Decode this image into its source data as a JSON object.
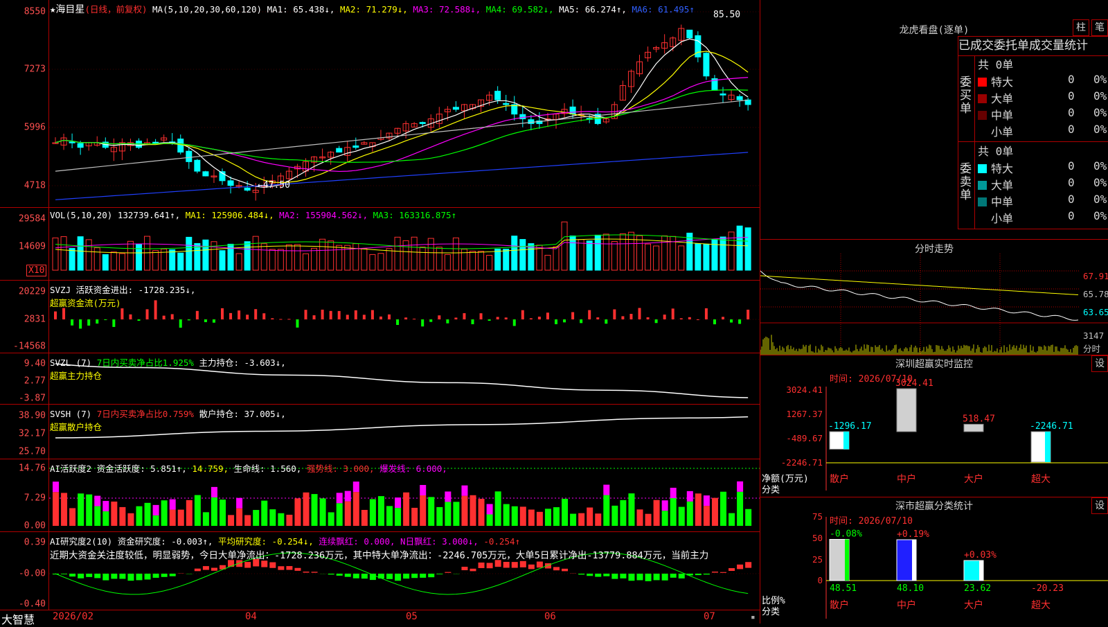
{
  "colors": {
    "up": "#ff3030",
    "down": "#00ffff",
    "bg": "#000000",
    "grid": "#b00000",
    "ma1": "#ffffff",
    "ma2": "#ffff00",
    "ma3": "#ff00ff",
    "ma4": "#00ff00",
    "ma5": "#c0c0c0",
    "ma6": "#2040ff"
  },
  "main_chart": {
    "title": "★海目星",
    "period": "(日线，前复权)",
    "ma_params": "MA(5,10,20,30,60,120)",
    "ma1": "MA1: 65.438↓,",
    "ma2": "MA2: 71.279↓,",
    "ma3": "MA3: 72.588↓,",
    "ma4": "MA4: 69.582↓,",
    "ma5": "MA5: 66.274↑,",
    "ma6": "MA6: 61.495↑",
    "y_ticks": [
      "8550",
      "7273",
      "5996",
      "4718"
    ],
    "high_label": "85.50",
    "low_label": "←47.50"
  },
  "volume": {
    "legend": "VOL(5,10,20)",
    "value": "132739.641↑,",
    "ma1": "MA1: 125906.484↓,",
    "ma2": "MA2: 155904.562↓,",
    "ma3": "MA3: 163316.875↑",
    "y_ticks": [
      "29584",
      "14609"
    ],
    "unit": "X10"
  },
  "svzj": {
    "legend": "SVZJ  活跃资金进出: -1728.235↓,",
    "sub": "超赢资金流(万元)",
    "y_ticks": [
      "20229",
      "2831",
      "-14568"
    ]
  },
  "svzl": {
    "legend_a": "SVZL (7)",
    "legend_b": "7日内买卖净占比1.925%",
    "legend_c": "主力持仓: -3.603↓,",
    "sub": "超赢主力持仓",
    "y_ticks": [
      "9.40",
      "2.77",
      "-3.87"
    ]
  },
  "svsh": {
    "legend_a": "SVSH (7)",
    "legend_b": "7日内买卖净占比0.759%",
    "legend_c": "散户持仓: 37.005↓,",
    "sub": "超赢散户持仓",
    "y_ticks": [
      "38.90",
      "32.17",
      "25.70"
    ]
  },
  "ai_active": {
    "a": "AI活跃度2 资金活跃度: 5.851↑,",
    "b": "14.759,",
    "c": "生命线: 1.560,",
    "d": "强势线: 3.000,",
    "e": "爆发线: 6.000,",
    "y_ticks": [
      "14.76",
      "7.29",
      "0.00"
    ]
  },
  "ai_research": {
    "a": "AI研究度2(10) 资金研究度: -0.003↑,",
    "b": "平均研究度: -0.254↓,",
    "c": "连续飘红: 0.000,",
    "d": "N日飘红: 3.000↓,",
    "e": "-0.254↑",
    "text": "近期大资金关注度较低，明显弱势，今日大单净流出：-1728.236万元，其中特大单净流出：-2246.705万元，大单5日累计净出-13779.884万元，当前主力",
    "y_ticks": [
      "0.39",
      "-0.00",
      "-0.40"
    ]
  },
  "x_axis": {
    "brand": "大智慧",
    "labels": [
      "2026/02",
      "04",
      "05",
      "06",
      "07"
    ]
  },
  "longhu": {
    "title": "龙虎看盘(逐单)",
    "btn_a": "柱",
    "btn_b": "笔",
    "tabs": [
      "已成交",
      "委托单",
      "成交量统计"
    ],
    "buy": {
      "side_label": "委买单",
      "total": "共 0单",
      "rows": [
        {
          "name": "特大",
          "count": "0",
          "pct": "0%"
        },
        {
          "name": "大单",
          "count": "0",
          "pct": "0%"
        },
        {
          "name": "中单",
          "count": "0",
          "pct": "0%"
        },
        {
          "name": "小单",
          "count": "0",
          "pct": "0%"
        }
      ]
    },
    "sell": {
      "side_label": "委卖单",
      "total": "共 0单",
      "rows": [
        {
          "name": "特大",
          "count": "0",
          "pct": "0%"
        },
        {
          "name": "大单",
          "count": "0",
          "pct": "0%"
        },
        {
          "name": "中单",
          "count": "0",
          "pct": "0%"
        },
        {
          "name": "小单",
          "count": "0",
          "pct": "0%"
        }
      ]
    }
  },
  "minute": {
    "title": "分时走势",
    "y_labels": [
      "67.91",
      "65.78",
      "63.65"
    ],
    "vol_label": "3147",
    "vol_unit": "分时"
  },
  "sz_monitor": {
    "title": "深圳超赢实时监控",
    "btn": "设",
    "time": "时间: 2026/07/10",
    "y_ticks": [
      "3024.41",
      "1267.37",
      "-489.67",
      "-2246.71"
    ],
    "ylab1": "净额(万元)",
    "ylab2": "分类",
    "bars": [
      {
        "cat": "散户",
        "value": "-1296.17"
      },
      {
        "cat": "中户",
        "value": "3024.41"
      },
      {
        "cat": "大户",
        "value": "518.47"
      },
      {
        "cat": "超大",
        "value": "-2246.71"
      }
    ]
  },
  "sz_class": {
    "title": "深市超赢分类统计",
    "btn": "设",
    "time": "时间: 2026/07/10",
    "y_ticks": [
      "75",
      "50",
      "25",
      "0"
    ],
    "ylab1": "比例%",
    "ylab2": "分类",
    "bars": [
      {
        "cat": "散户",
        "top": "-0.08%",
        "bottom": "48.51"
      },
      {
        "cat": "中户",
        "top": "+0.19%",
        "bottom": "48.10"
      },
      {
        "cat": "大户",
        "top": "+0.03%",
        "bottom": "23.62"
      },
      {
        "cat": "超大",
        "top": "",
        "bottom": "-20.23"
      }
    ]
  }
}
